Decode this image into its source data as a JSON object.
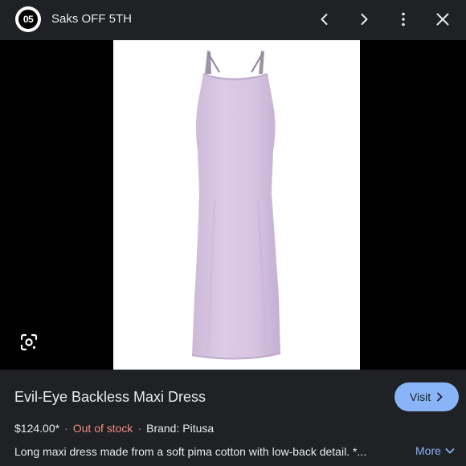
{
  "header": {
    "logo_text": "05",
    "site_name": "Saks OFF 5TH"
  },
  "icons": {
    "prev": "chevron-left-icon",
    "next": "chevron-right-icon",
    "menu": "more-vert-icon",
    "close": "close-icon",
    "lens": "google-lens-icon"
  },
  "product": {
    "title": "Evil-Eye Backless Maxi Dress",
    "price": "$124.00*",
    "stock_status": "Out of stock",
    "brand": "Brand: Pitusa",
    "separator": "·",
    "description": "Long maxi dress made from a soft pima cotton with low-back detail. *...",
    "image_alt": "Lavender maxi slip dress"
  },
  "actions": {
    "visit_label": "Visit",
    "more_label": "More"
  },
  "colors": {
    "background": "#202124",
    "accent": "#8ab4f8",
    "out_of_stock": "#f28b82",
    "dress": "#d9c9e3"
  }
}
